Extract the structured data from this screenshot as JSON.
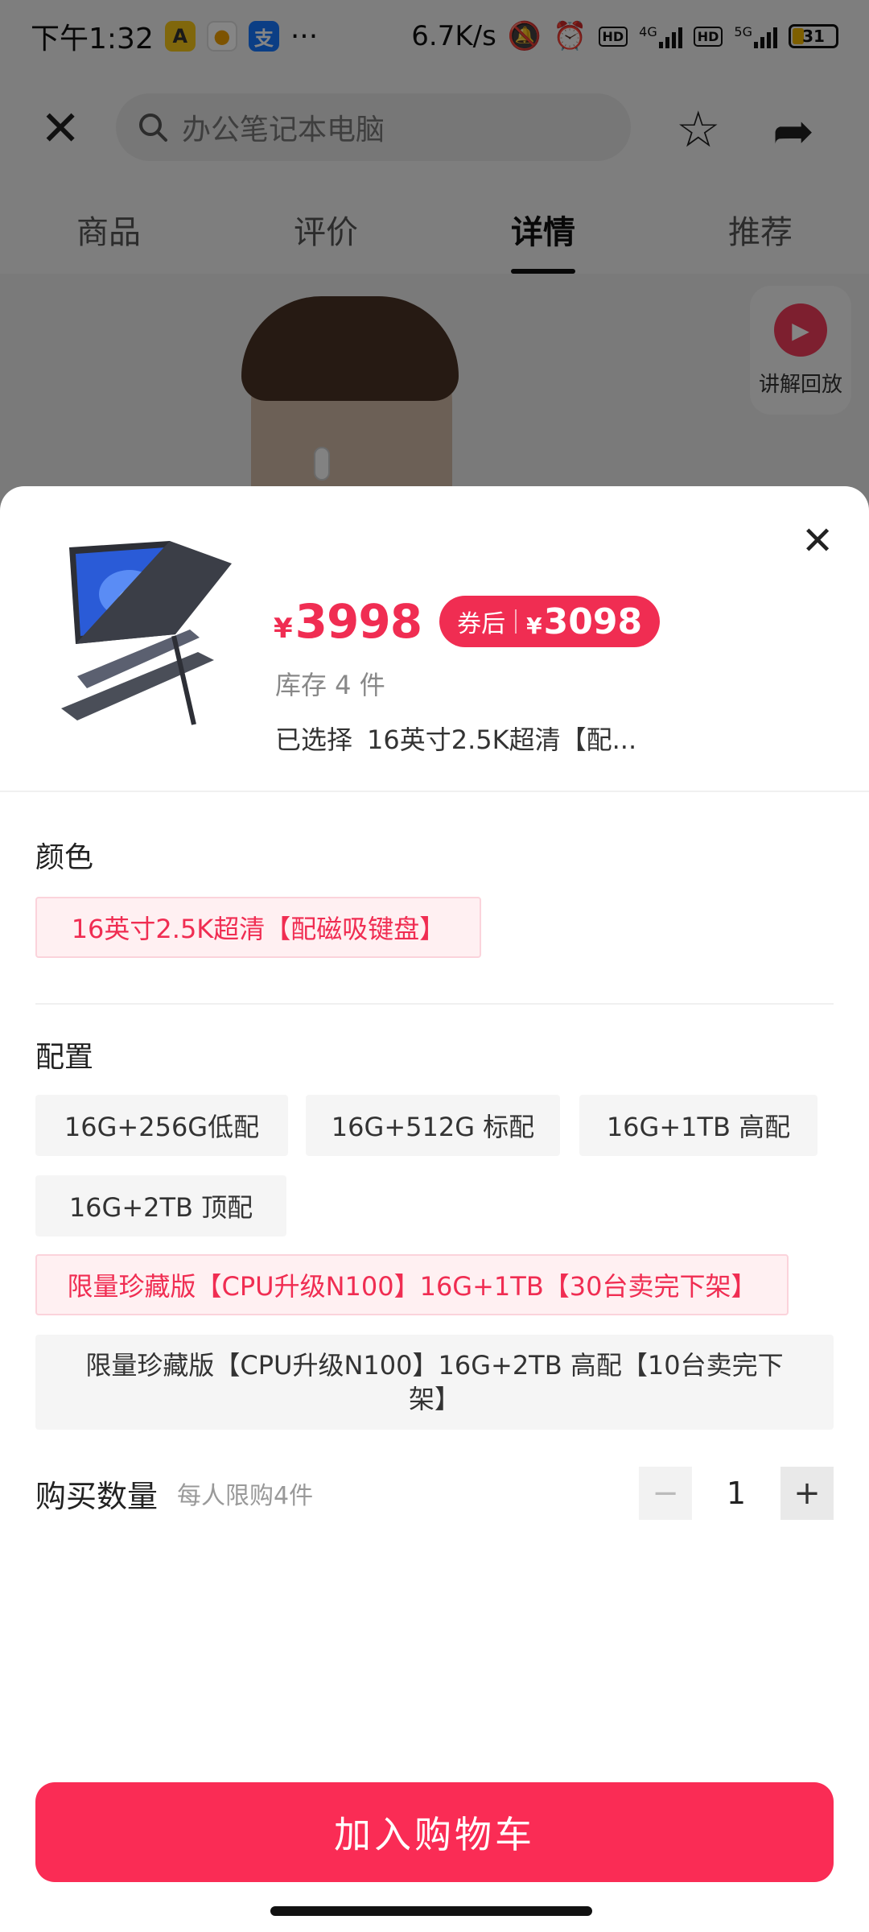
{
  "status_bar": {
    "time": "下午1:32",
    "speed": "6.7K/s",
    "battery": "31",
    "net1": "4G",
    "net2": "5G",
    "hd": "HD"
  },
  "header": {
    "search_placeholder": "办公笔记本电脑",
    "tabs": [
      {
        "label": "商品"
      },
      {
        "label": "评价"
      },
      {
        "label": "详情"
      },
      {
        "label": "推荐"
      }
    ],
    "active_tab": "详情",
    "replay_label": "讲解回放"
  },
  "sheet": {
    "currency": "¥",
    "price": "3998",
    "coupon_label": "券后",
    "coupon_price": "3098",
    "stock": "库存 4 件",
    "selected_label": "已选择",
    "selected_value": "16英寸2.5K超清【配...",
    "color_title": "颜色",
    "color_options": [
      {
        "label": "16英寸2.5K超清【配磁吸键盘】",
        "selected": true
      }
    ],
    "config_title": "配置",
    "config_options": [
      {
        "label": "16G+256G低配",
        "selected": false
      },
      {
        "label": "16G+512G 标配",
        "selected": false
      },
      {
        "label": "16G+1TB 高配",
        "selected": false
      },
      {
        "label": "16G+2TB  顶配",
        "selected": false
      },
      {
        "label": "限量珍藏版【CPU升级N100】16G+1TB【30台卖完下架】",
        "selected": true
      },
      {
        "label": "限量珍藏版【CPU升级N100】16G+2TB 高配【10台卖完下架】",
        "selected": false
      }
    ],
    "qty_label": "购买数量",
    "qty_hint": "每人限购4件",
    "qty_value": "1",
    "qty_minus": "−",
    "qty_plus": "+",
    "cart_button": "加入购物车"
  },
  "colors": {
    "accent": "#f02d52",
    "cart": "#fa2c55",
    "selected_bg": "#fff0f2"
  }
}
